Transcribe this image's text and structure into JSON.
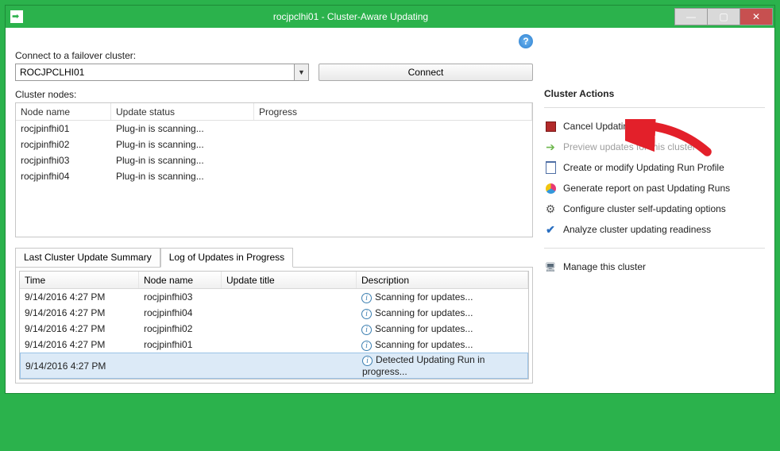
{
  "window": {
    "title": "rocjpclhi01 - Cluster-Aware Updating"
  },
  "connect": {
    "label": "Connect to a failover cluster:",
    "value": "ROCJPCLHI01",
    "button": "Connect"
  },
  "nodes": {
    "label": "Cluster nodes:",
    "columns": {
      "c1": "Node name",
      "c2": "Update status",
      "c3": "Progress"
    },
    "rows": [
      {
        "name": "rocjpinfhi01",
        "status": "Plug-in is scanning..."
      },
      {
        "name": "rocjpinfhi02",
        "status": "Plug-in is scanning..."
      },
      {
        "name": "rocjpinfhi03",
        "status": "Plug-in is scanning..."
      },
      {
        "name": "rocjpinfhi04",
        "status": "Plug-in is scanning..."
      }
    ]
  },
  "tabs": {
    "summary": "Last Cluster Update Summary",
    "log": "Log of Updates in Progress"
  },
  "log": {
    "columns": {
      "c1": "Time",
      "c2": "Node name",
      "c3": "Update title",
      "c4": "Description"
    },
    "rows": [
      {
        "time": "9/14/2016 4:27 PM",
        "node": "rocjpinfhi03",
        "title": "",
        "desc": "Scanning for updates..."
      },
      {
        "time": "9/14/2016 4:27 PM",
        "node": "rocjpinfhi04",
        "title": "",
        "desc": "Scanning for updates..."
      },
      {
        "time": "9/14/2016 4:27 PM",
        "node": "rocjpinfhi02",
        "title": "",
        "desc": "Scanning for updates..."
      },
      {
        "time": "9/14/2016 4:27 PM",
        "node": "rocjpinfhi01",
        "title": "",
        "desc": "Scanning for updates..."
      },
      {
        "time": "9/14/2016 4:27 PM",
        "node": "",
        "title": "",
        "desc": "Detected Updating Run in progress..."
      }
    ]
  },
  "actions": {
    "title": "Cluster Actions",
    "cancel": "Cancel Updating Run",
    "preview": "Preview updates for this cluster",
    "profile": "Create or modify Updating Run Profile",
    "report": "Generate report on past Updating Runs",
    "configure": "Configure cluster self-updating options",
    "analyze": "Analyze cluster updating readiness",
    "manage": "Manage this cluster"
  }
}
